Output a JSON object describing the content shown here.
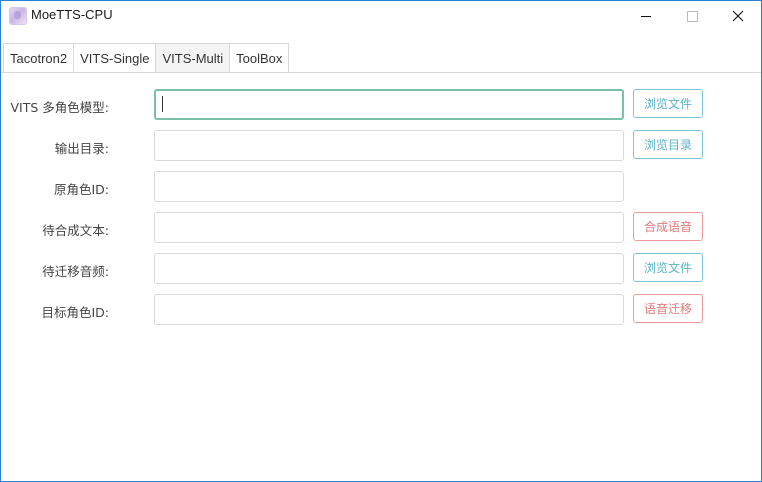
{
  "window": {
    "title": "MoeTTS-CPU"
  },
  "tabs": [
    {
      "label": "Tacotron2",
      "active": false
    },
    {
      "label": "VITS-Single",
      "active": false
    },
    {
      "label": "VITS-Multi",
      "active": true
    },
    {
      "label": "ToolBox",
      "active": false
    }
  ],
  "form": {
    "model": {
      "label": "VITS 多角色模型:",
      "value": "",
      "button": "浏览文件"
    },
    "output_dir": {
      "label": "输出目录:",
      "value": "",
      "button": "浏览目录"
    },
    "source_id": {
      "label": "原角色ID:",
      "value": ""
    },
    "text": {
      "label": "待合成文本:",
      "value": "",
      "button": "合成语音"
    },
    "audio": {
      "label": "待迁移音频:",
      "value": "",
      "button": "浏览文件"
    },
    "target_id": {
      "label": "目标角色ID:",
      "value": "",
      "button": "语音迁移"
    }
  },
  "colors": {
    "accent_blue": "#5cb3c6",
    "accent_red": "#e27b7b",
    "focus_green": "#7ac0a8",
    "window_border": "#2b7fd6"
  }
}
